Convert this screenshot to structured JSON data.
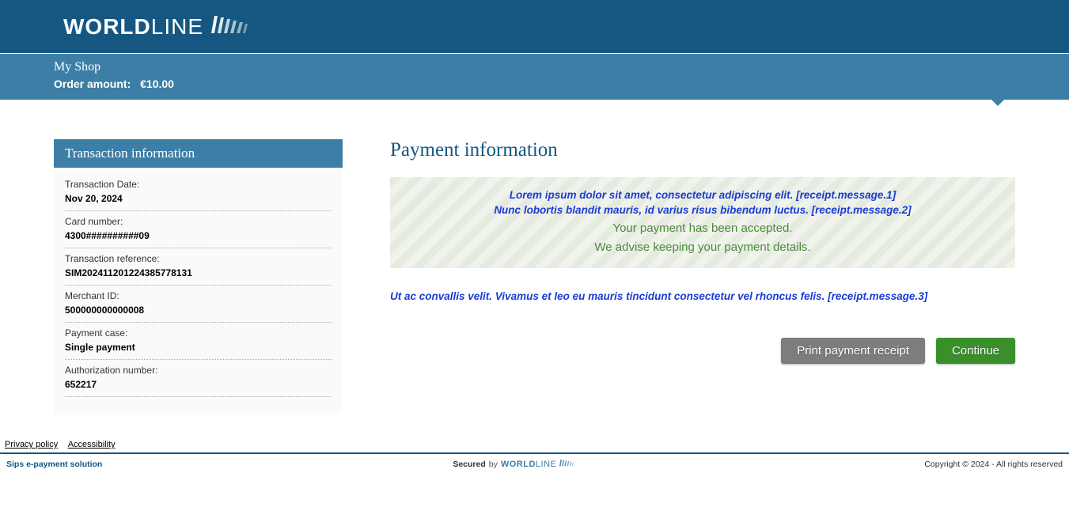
{
  "brand": {
    "bold": "WORLD",
    "thin": "LINE"
  },
  "shop": {
    "name": "My Shop",
    "order_label": "Order amount:",
    "order_amount": "€10.00"
  },
  "sidebar": {
    "title": "Transaction information",
    "fields": [
      {
        "label": "Transaction Date:",
        "value": "Nov 20, 2024"
      },
      {
        "label": "Card number:",
        "value": "4300##########09"
      },
      {
        "label": "Transaction reference:",
        "value": "SIM202411201224385778131"
      },
      {
        "label": "Merchant ID:",
        "value": "500000000000008"
      },
      {
        "label": "Payment case:",
        "value": "Single payment"
      },
      {
        "label": "Authorization number:",
        "value": "652217"
      }
    ]
  },
  "main": {
    "title": "Payment information",
    "msg1": "Lorem ipsum dolor sit amet, consectetur adipiscing elit. [receipt.message.1]",
    "msg2": "Nunc lobortis blandit mauris, id varius risus bibendum luctus. [receipt.message.2]",
    "accepted1": "Your payment has been accepted.",
    "accepted2": "We advise keeping your payment details.",
    "msg3": "Ut ac convallis velit. Vivamus et leo eu mauris tincidunt consectetur vel rhoncus felis. [receipt.message.3]",
    "print_label": "Print payment receipt",
    "continue_label": "Continue"
  },
  "footer": {
    "privacy": "Privacy policy",
    "accessibility": "Accessibility",
    "solution": "Sips e-payment solution",
    "secured": "Secured",
    "by": "by",
    "copyright": "Copyright © 2024 - All rights reserved"
  }
}
